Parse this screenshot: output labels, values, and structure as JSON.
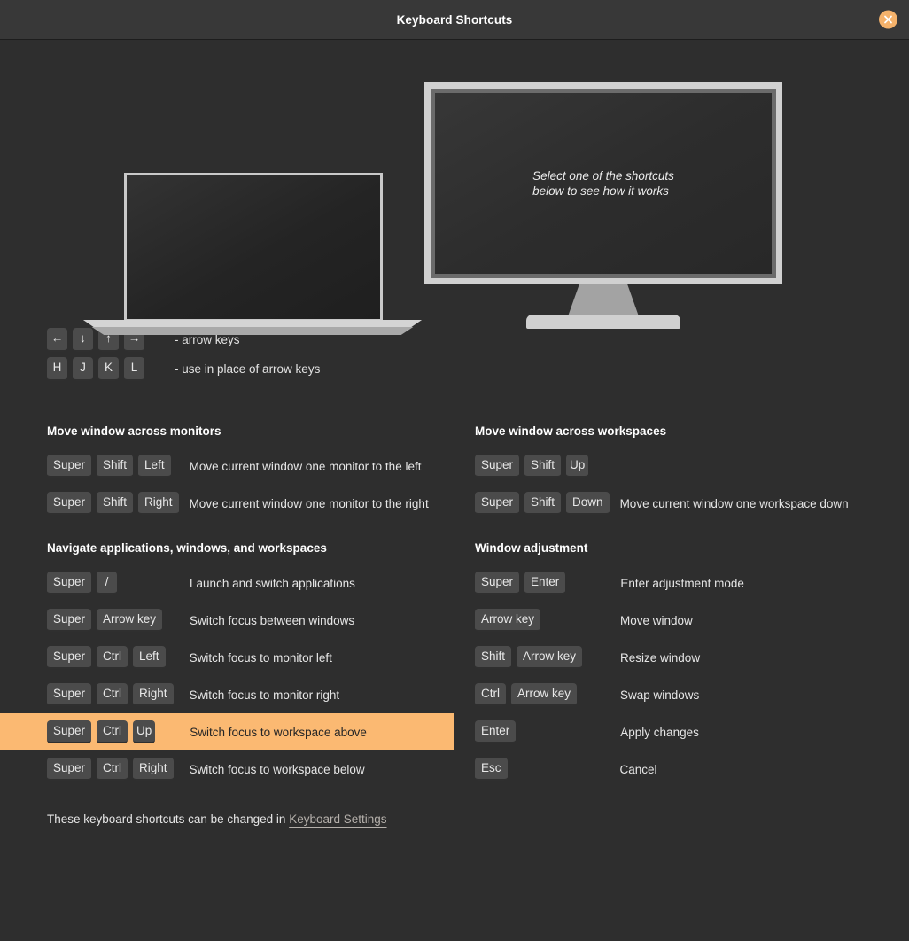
{
  "window": {
    "title": "Keyboard Shortcuts",
    "close_icon": "close-x-icon",
    "accent_color": "#f5b26b",
    "background_color": "#2e2e2e",
    "selected_row_color": "#fbb972"
  },
  "illustration": {
    "monitor_hint": "Select one of the shortcuts\nbelow to see how it works",
    "laptop_name": "laptop-illustration",
    "monitor_name": "monitor-illustration"
  },
  "legend": [
    {
      "keys": [
        "←",
        "↓",
        "↑",
        "→"
      ],
      "note": "- arrow keys"
    },
    {
      "keys": [
        "H",
        "J",
        "K",
        "L"
      ],
      "note": "- use in place of arrow keys"
    }
  ],
  "columns": {
    "left": [
      {
        "title": "Move window across monitors",
        "rows": [
          {
            "keys": [
              "Super",
              "Shift",
              "Left"
            ],
            "desc": "Move current window one monitor to the left",
            "selected": false
          },
          {
            "keys": [
              "Super",
              "Shift",
              "Right"
            ],
            "desc": "Move current window one monitor to the right",
            "selected": false
          }
        ]
      },
      {
        "title": "Navigate applications, windows, and workspaces",
        "rows": [
          {
            "keys": [
              "Super",
              "/"
            ],
            "desc": "Launch and switch applications",
            "selected": false
          },
          {
            "keys": [
              "Super",
              "Arrow key"
            ],
            "desc": "Switch focus between windows",
            "selected": false
          },
          {
            "keys": [
              "Super",
              "Ctrl",
              "Left"
            ],
            "desc": "Switch focus to monitor left",
            "selected": false
          },
          {
            "keys": [
              "Super",
              "Ctrl",
              "Right"
            ],
            "desc": "Switch focus to monitor right",
            "selected": false
          },
          {
            "keys": [
              "Super",
              "Ctrl",
              "Up"
            ],
            "desc": "Switch focus to workspace above",
            "selected": true
          },
          {
            "keys": [
              "Super",
              "Ctrl",
              "Right"
            ],
            "desc": "Switch focus to workspace below",
            "selected": false
          }
        ]
      }
    ],
    "right": [
      {
        "title": "Move window across workspaces",
        "rows": [
          {
            "keys": [
              "Super",
              "Shift",
              "Up"
            ],
            "desc": "",
            "selected": false
          },
          {
            "keys": [
              "Super",
              "Shift",
              "Down"
            ],
            "desc": "Move current window one workspace down",
            "selected": false
          }
        ]
      },
      {
        "title": "Window adjustment",
        "rows": [
          {
            "keys": [
              "Super",
              "Enter"
            ],
            "desc": "Enter adjustment mode",
            "selected": false
          },
          {
            "keys": [
              "Arrow key"
            ],
            "desc": "Move window",
            "selected": false
          },
          {
            "keys": [
              "Shift",
              "Arrow key"
            ],
            "desc": "Resize window",
            "selected": false
          },
          {
            "keys": [
              "Ctrl",
              "Arrow key"
            ],
            "desc": "Swap windows",
            "selected": false
          },
          {
            "keys": [
              "Enter"
            ],
            "desc": "Apply changes",
            "selected": false
          },
          {
            "keys": [
              "Esc"
            ],
            "desc": "Cancel",
            "selected": false
          }
        ]
      }
    ]
  },
  "footer": {
    "text": "These keyboard shortcuts can be changed in",
    "link": "Keyboard Settings"
  }
}
